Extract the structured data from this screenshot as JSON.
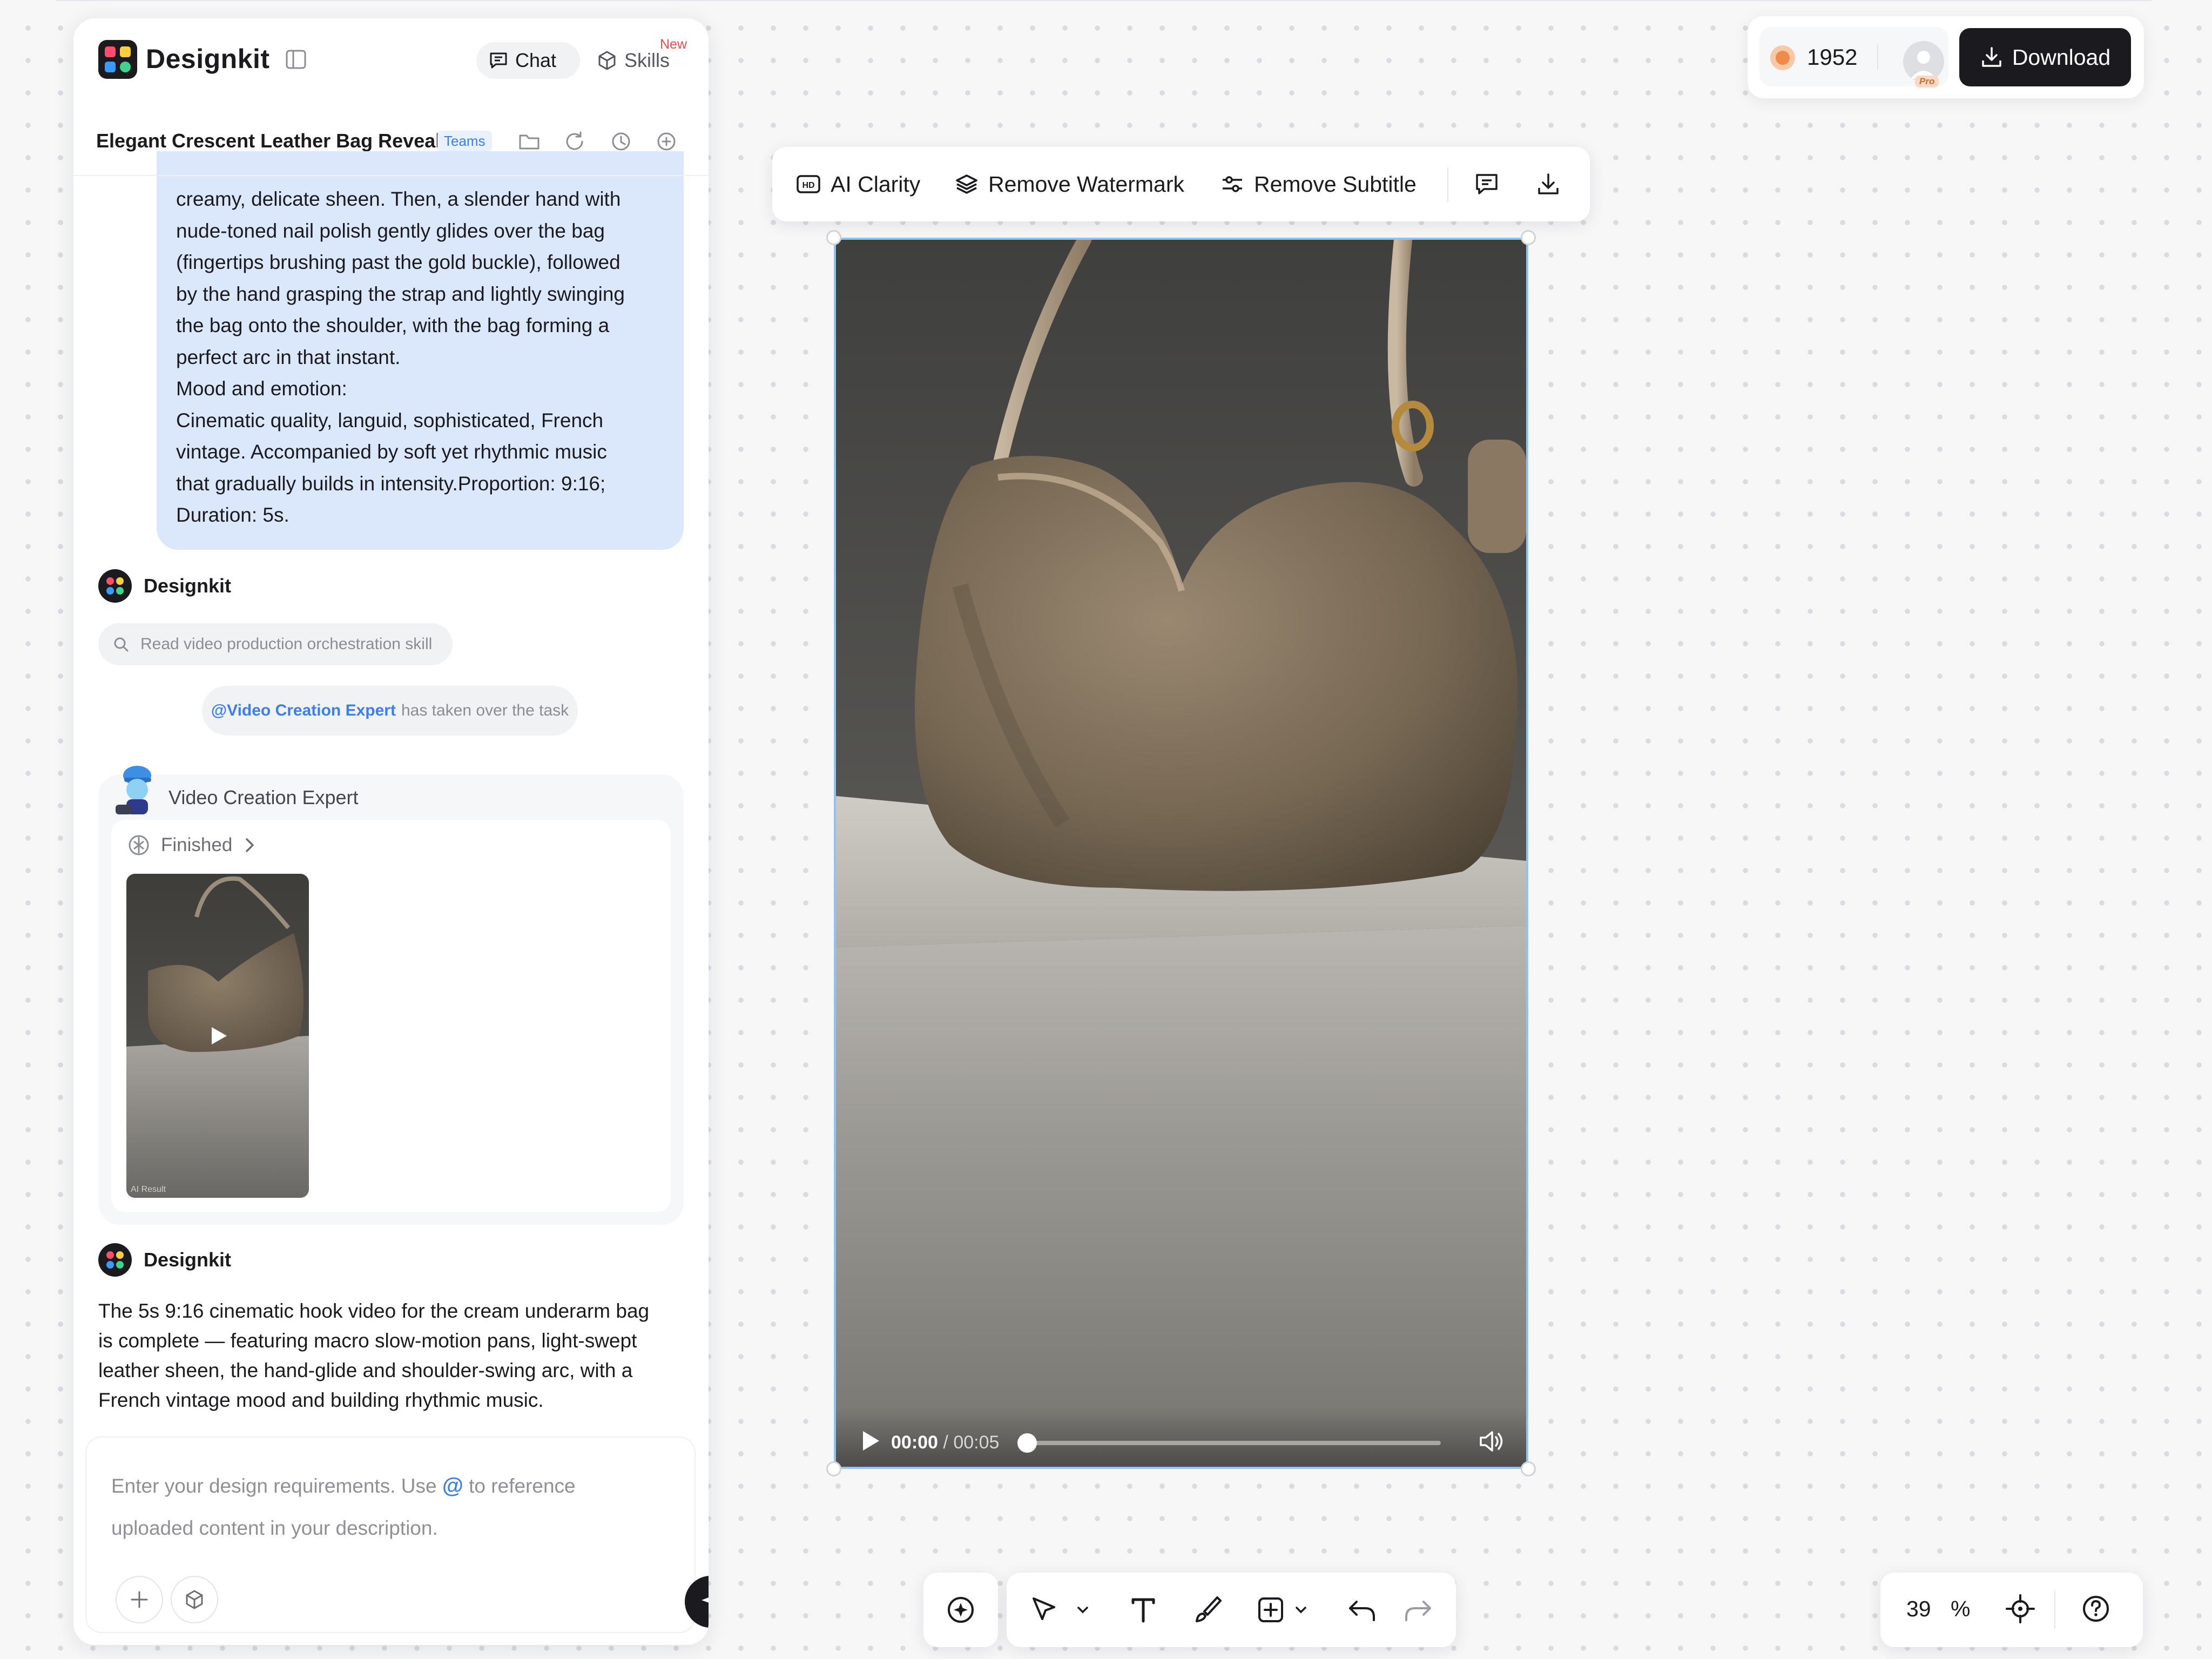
{
  "app": {
    "name": "Designkit"
  },
  "header": {
    "chat_label": "Chat",
    "skills_label": "Skills",
    "new_badge": "New",
    "project_title": "Elegant Crescent Leather Bag Reveal",
    "teams_badge": "Teams"
  },
  "conversation": {
    "user_prompt_lines": [
      "creamy, delicate sheen. Then, a slender hand with",
      "nude-toned nail polish gently glides over the bag",
      "(fingertips brushing past the gold buckle), followed",
      "by the hand grasping the strap and lightly swinging",
      "the bag onto the shoulder, with the bag forming a",
      "perfect arc in that instant.",
      "Mood and emotion:",
      "Cinematic quality, languid, sophisticated, French",
      "vintage. Accompanied by soft yet rhythmic music",
      "that gradually builds in intensity.Proportion: 9:16;",
      "Duration: 5s."
    ],
    "assistant_name": "Designkit",
    "skill_step": "Read video production orchestration skill",
    "handoff_mention": "@Video Creation Expert",
    "handoff_text": "has taken over the task",
    "expert_name": "Video Creation Expert",
    "expert_status": "Finished",
    "thumbnail_watermark": "AI Result",
    "final_assistant_name": "Designkit",
    "final_message_lines": [
      "The 5s 9:16 cinematic hook video for the cream underarm bag",
      "is complete — featuring macro slow-motion pans, light-swept",
      "leather sheen, the hand-glide and shoulder-swing arc, with a",
      "French vintage mood and building rhythmic music."
    ]
  },
  "composer": {
    "placeholder_before": "Enter your design requirements. Use",
    "at_symbol": "@",
    "placeholder_after": "to reference",
    "placeholder_line2": "uploaded content in your description."
  },
  "video_toolbar": {
    "ai_clarity": "AI Clarity",
    "remove_watermark": "Remove Watermark",
    "remove_subtitle": "Remove Subtitle"
  },
  "video": {
    "current_time": "00:00",
    "duration": "/ 00:05",
    "progress": 0
  },
  "account": {
    "credits": "1952",
    "badge": "Pro",
    "download_label": "Download"
  },
  "zoom": {
    "value": "39",
    "unit": "%"
  },
  "colors": {
    "accent": "#3b7df2",
    "user_bubble": "#dbe8fc",
    "dark": "#1b1b1f",
    "new_badge": "#f04a4a",
    "selection": "#8ec4f3"
  }
}
